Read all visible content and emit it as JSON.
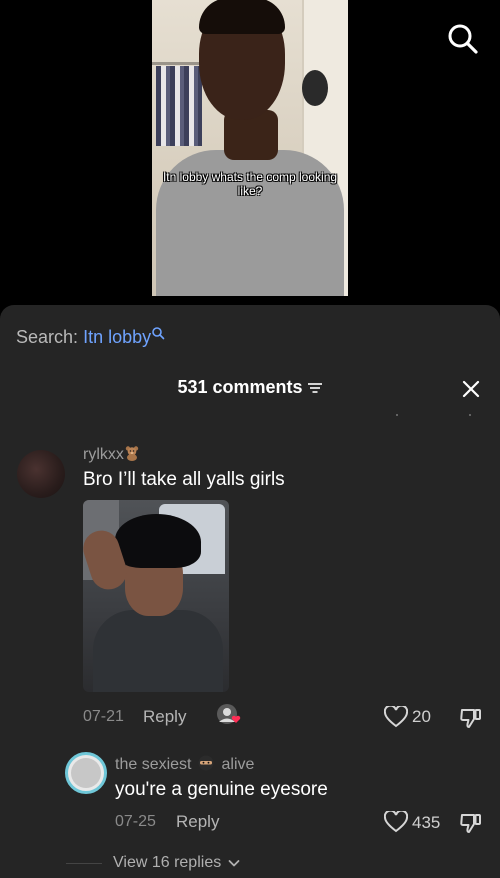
{
  "video": {
    "caption": "Itn lobby whats the comp looking like?",
    "search_icon": "search-icon"
  },
  "sheet": {
    "search_prefix": "Search:",
    "search_query": "Itn lobby",
    "comment_count": "531 comments",
    "filter_icon": "filter-icon",
    "close_icon": "close-icon"
  },
  "comments": [
    {
      "username": "rylkxx",
      "username_emoji_icon": "teddy-bear-icon",
      "text": "Bro I’ll take all yalls girls",
      "date": "07-21",
      "reply_label": "Reply",
      "likes": "20",
      "liked_by_creator_icon": "creator-like-avatar-icon"
    }
  ],
  "reply": {
    "username": "the sexiest",
    "username_suffix": "alive",
    "username_emoji_icon": "ninja-icon",
    "text": "you're a genuine eyesore",
    "date": "07-25",
    "reply_label": "Reply",
    "likes": "435"
  },
  "view_replies": "View 16 replies",
  "colors": {
    "sheet_bg": "#252525",
    "accent_blue": "#6fa3ff",
    "heart_red": "#ff2d55",
    "avatar_ring": "#6fc7d8"
  }
}
